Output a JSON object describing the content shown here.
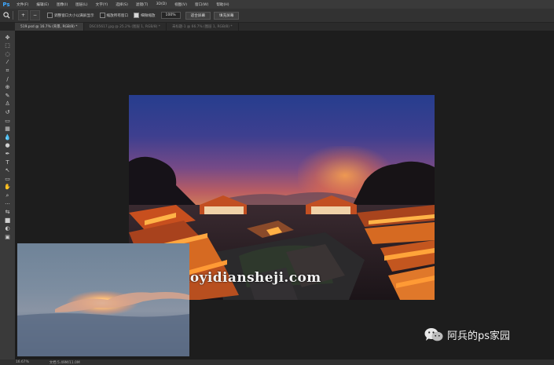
{
  "app": {
    "logo": "Ps"
  },
  "menu": [
    "文件(F)",
    "编辑(E)",
    "图像(I)",
    "图层(L)",
    "文字(Y)",
    "选择(S)",
    "滤镜(T)",
    "3D(D)",
    "视图(V)",
    "窗口(W)",
    "帮助(H)"
  ],
  "options": {
    "tool_icon": "magnifier-icon",
    "zoom_in": "+",
    "zoom_out": "−",
    "resize_windows": "调整窗口大小以满屏显示",
    "zoom_all_windows": "缩放所有窗口",
    "scrubby_zoom": "细微缩放",
    "zoom_value": "100%",
    "fit_screen": "适合屏幕",
    "fill_screen": "填充屏幕"
  },
  "tabs": [
    {
      "label": "519.psd @ 16.7% (背景, RGB/8) *",
      "active": true
    },
    {
      "label": "DSC05617.jpg @ 25.2% (图层 1, RGB/8) *",
      "active": false
    },
    {
      "label": "未标题-1 @ 66.7% (图层 1, RGB/8) *",
      "active": false
    }
  ],
  "toolbar_icons": [
    "move-icon",
    "marquee-icon",
    "lasso-icon",
    "magic-wand-icon",
    "crop-icon",
    "eyedropper-icon",
    "healing-brush-icon",
    "brush-icon",
    "clone-stamp-icon",
    "history-brush-icon",
    "eraser-icon",
    "gradient-icon",
    "blur-icon",
    "dodge-icon",
    "pen-icon",
    "type-icon",
    "path-select-icon",
    "shape-icon",
    "hand-icon",
    "zoom-icon",
    "more-tools-icon",
    "swap-colors-icon",
    "color-swatches-icon",
    "quick-mask-icon",
    "screen-mode-icon"
  ],
  "toolbar_glyphs": [
    "✥",
    "⬚",
    "◌",
    "⁄",
    "⌗",
    "∕",
    "⊕",
    "✎",
    "♙",
    "↺",
    "▭",
    "▦",
    "💧",
    "●",
    "✒",
    "T",
    "↖",
    "▭",
    "✋",
    "⌕",
    "···",
    "⇆",
    "■",
    "◐",
    "▣"
  ],
  "canvas": {
    "watermark": "www.haoyidiansheji.com",
    "brand": "阿兵的ps家园",
    "brand_icon": "wechat-icon"
  },
  "status": {
    "zoom": "16.67%",
    "doc_info": "文档:5.49M/11.0M"
  }
}
